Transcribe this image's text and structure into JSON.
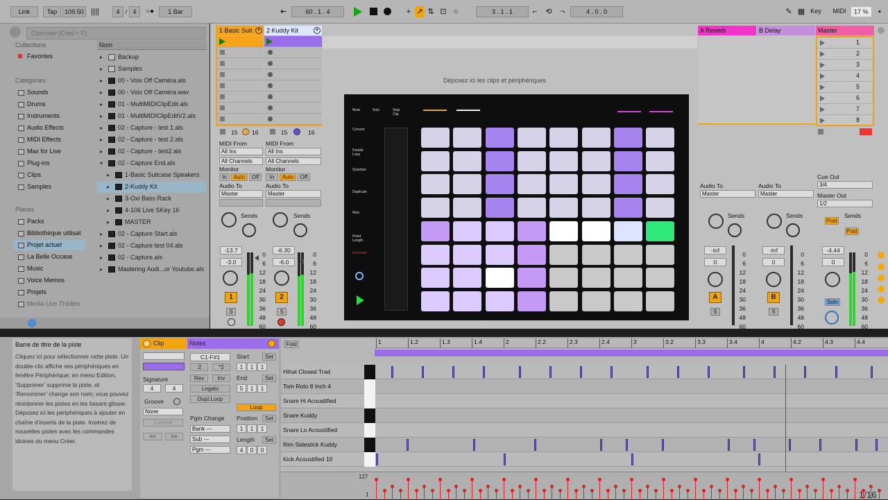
{
  "transport": {
    "link": "Link",
    "tap": "Tap",
    "tempo": "109.50",
    "sig_num": "4",
    "sig_den": "4",
    "quant": "1 Bar",
    "position": "60 . 1 . 4",
    "loop_start": "3 . 1 . 1",
    "loop_len": "4 . 0 . 0",
    "key": "Key",
    "midi": "MIDI",
    "cpu": "17 %",
    "metro": "○●",
    "wave": "||||"
  },
  "browser": {
    "search_placeholder": "Chercher (Cmd + F)",
    "collections_header": "Collections",
    "favorites": "Favorites",
    "categories_header": "Catégories",
    "categories": [
      "Sounds",
      "Drums",
      "Instruments",
      "Audio Effects",
      "MIDI Effects",
      "Max for Live",
      "Plug-ins",
      "Clips",
      "Samples"
    ],
    "places_header": "Places",
    "places": [
      "Packs",
      "Bibliothèque utilisat",
      "Projet actuel",
      "La Belle Occase",
      "Music",
      "Voice Memos",
      "Projets",
      "Media Live Théâtre"
    ],
    "name_column": "Nom",
    "files": [
      "Backup",
      "Samples",
      "00 - Voix Off Caméra.als",
      "00 - Voix Off Caméra.wav",
      "01 - MultiMIDIClipEdit.als",
      "01 - MultiMIDIClipEditV2.als",
      "02 - Capture - test 1.als",
      "02 - Capture - test 2.als",
      "02 - Capture - test2.als",
      "02 - Capture End.als",
      "1-Basic Suitcase Speakers",
      "2-Kuddy Kit",
      "3-Oxi Bass Rack",
      "4-106 Live SKey 16",
      "MASTER",
      "02 - Capture Start.als",
      "02 - Capture test 04.als",
      "02 - Capture.als",
      "Mastering Audi...or Youtube.als"
    ]
  },
  "tracks": [
    {
      "name": "1 Basic Suit",
      "number": "1",
      "vol": "-13.7",
      "pan": "-3.0",
      "input": "All Ins",
      "channel": "All Channels",
      "output": "Master",
      "color": "#f7a41c",
      "slot_l": "15",
      "slot_r": "16"
    },
    {
      "name": "2 Kuddy Kit",
      "number": "2",
      "vol": "-6.30",
      "pan": "-6.0",
      "input": "All Ins",
      "channel": "All Channels",
      "output": "Master",
      "color": "#9a6ee8",
      "slot_l": "15",
      "slot_r": "16"
    }
  ],
  "returns": [
    {
      "name": "A Reverb",
      "letter": "A",
      "output": "Master",
      "vol": "-Inf",
      "pan": "0",
      "color": "#f133c8"
    },
    {
      "name": "B Delay",
      "letter": "B",
      "output": "Master",
      "vol": "-Inf",
      "pan": "0",
      "color": "#c38fdc"
    }
  ],
  "master": {
    "name": "Master",
    "scenes": [
      "1",
      "2",
      "3",
      "4",
      "5",
      "6",
      "7",
      "8"
    ],
    "cue_out_label": "Cue Out",
    "cue_out": "3/4",
    "master_out_label": "Master Out",
    "master_out": "1/2",
    "vol": "-4.44",
    "pan": "0",
    "post": "Post",
    "solo": "Solo"
  },
  "mixer_labels": {
    "midi_from": "MIDI From",
    "monitor": "Monitor",
    "in": "In",
    "auto": "Auto",
    "off": "Off",
    "audio_to": "Audio To",
    "sends": "Sends",
    "s": "S"
  },
  "meter_scale": [
    "0",
    "6",
    "12",
    "18",
    "24",
    "30",
    "36",
    "48",
    "60"
  ],
  "drop_hint": "Déposez ici les clips et périphériques",
  "video_buttons": [
    "Mute",
    "Solo",
    "Stop Clip",
    "Convert",
    "Double Loop",
    "Quantize",
    "Duplicate",
    "New",
    "Fixed Length",
    "Automate"
  ],
  "info": {
    "title": "Barre de titre de la piste",
    "body": "Cliquez ici pour sélectionner cette piste. Un double-clic affiche ses périphériques en fenêtre Périphérique; en menu Edition, ‘Supprimer’ supprime la piste, et ‘Renommer’ change son nom; vous pouvez réordonner les pistes en les faisant glisser. Déposez ici les périphériques à ajouter en chaîne d’inserts de la piste. Insérez de nouvelles pistes avec les commandes idoines du menu Créer."
  },
  "clip_view": {
    "clip_tab": "Clip",
    "notes_tab": "Notes",
    "signature": "Signature",
    "sig_num": "4",
    "sig_den": "4",
    "groove": "Groove",
    "groove_val": "None",
    "commit": "Commit",
    "prev": "<<",
    "next": ">>",
    "range": "C1-F#1",
    "half": ":2",
    "double": "*2",
    "rev": "Rev",
    "inv": "Inv",
    "legato": "Legato",
    "dupl_loop": "Dupl.Loop",
    "pgm_change": "Pgm Change",
    "bank": "Bank ---",
    "sub": "Sub ---",
    "pgm": "Pgm ---",
    "start": "Start",
    "set": "Set",
    "end": "End",
    "loop": "Loop",
    "position": "Position",
    "length": "Length",
    "start_vals": [
      "1",
      "1",
      "1"
    ],
    "end_vals": [
      "5",
      "1",
      "1"
    ],
    "pos_vals": [
      "1",
      "1",
      "1"
    ],
    "len_vals": [
      "4",
      "0",
      "0"
    ]
  },
  "sequencer": {
    "fold": "Fold",
    "ruler": [
      "1",
      "1.2",
      "1.3",
      "1.4",
      "2",
      "2.2",
      "2.3",
      "2.4",
      "3",
      "3.2",
      "3.3",
      "3.4",
      "4",
      "4.2",
      "4.3",
      "4.4"
    ],
    "lanes": [
      "Hihat Closed Trad",
      "Tom Roto 8 Inch 4",
      "Snare Hi Acoustified",
      "Snare Kuddy",
      "Snare Lo Acoustified",
      "Rim Sidestick Kuddy",
      "Kick Acoustified 10"
    ],
    "vel_max": "127",
    "vel_min": "1",
    "grid": "1/16"
  }
}
